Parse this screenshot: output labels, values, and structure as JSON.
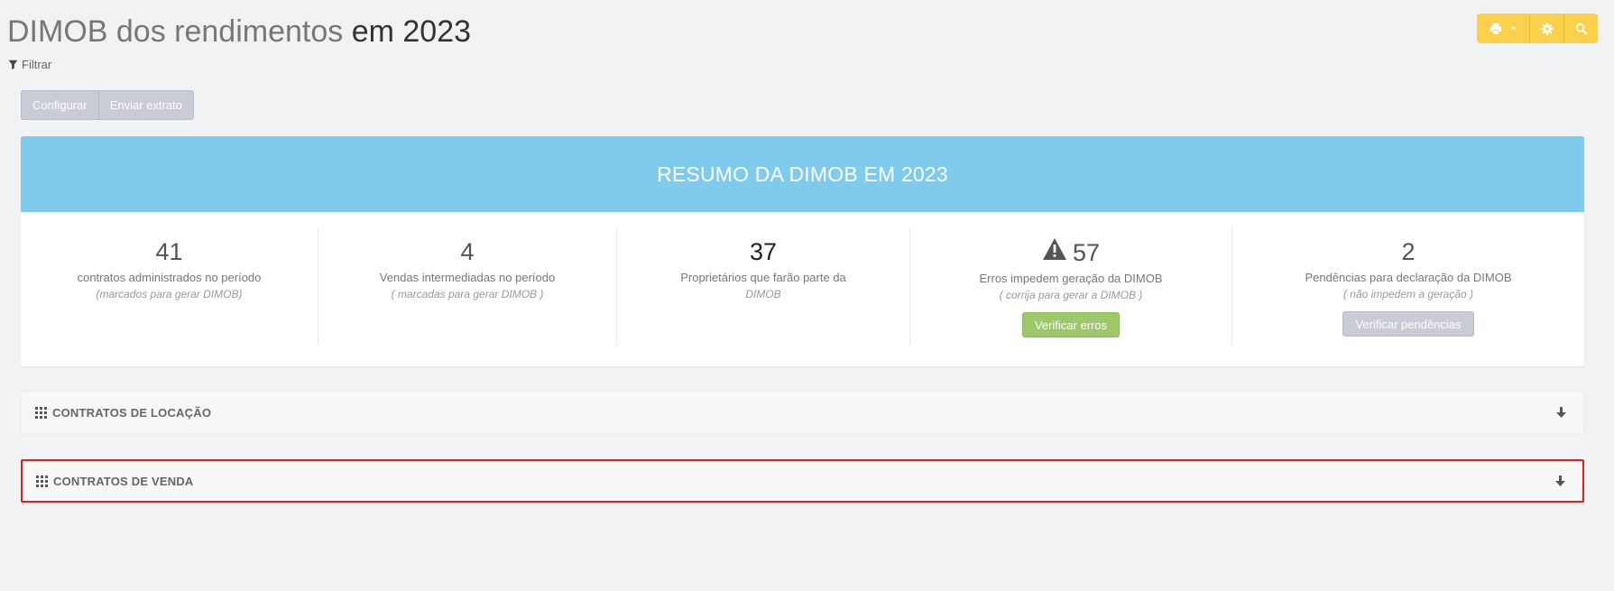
{
  "header": {
    "title_part1": "DIMOB dos rendimentos",
    "title_part2": "em 2023",
    "filter_label": "Filtrar"
  },
  "toolbar": {
    "icons": [
      "printer-icon",
      "caret-down-icon",
      "gear-icon",
      "search-icon"
    ],
    "accent": "#fbd14b"
  },
  "actions": {
    "configurar": "Configurar",
    "enviar_extrato": "Enviar extrato"
  },
  "summary": {
    "title": "RESUMO DA DIMOB EM 2023",
    "header_color": "#7ecbee",
    "stats": [
      {
        "value": "41",
        "label": "contratos administrados no período",
        "sub": "(marcados para gerar DIMOB)"
      },
      {
        "value": "4",
        "label": "Vendas intermediadas no período",
        "sub": "( marcadas para gerar DIMOB )"
      },
      {
        "value": "37",
        "label": "Proprietários que farão parte da",
        "sub": "DIMOB"
      },
      {
        "value": "57",
        "label": "Erros impedem geração da DIMOB",
        "sub": "( corrija para gerar a DIMOB )",
        "button": "Verificar erros",
        "icon": "warning-icon"
      },
      {
        "value": "2",
        "label": "Pendências para declaração da DIMOB",
        "sub": "( não impedem a geração )",
        "button": "Verificar pendências"
      }
    ]
  },
  "panels": {
    "locacao": "CONTRATOS DE LOCAÇÃO",
    "venda": "CONTRATOS DE VENDA"
  },
  "colors": {
    "success": "#9cc869",
    "muted_button": "#c9ccd4",
    "highlight": "#e01f1f"
  }
}
